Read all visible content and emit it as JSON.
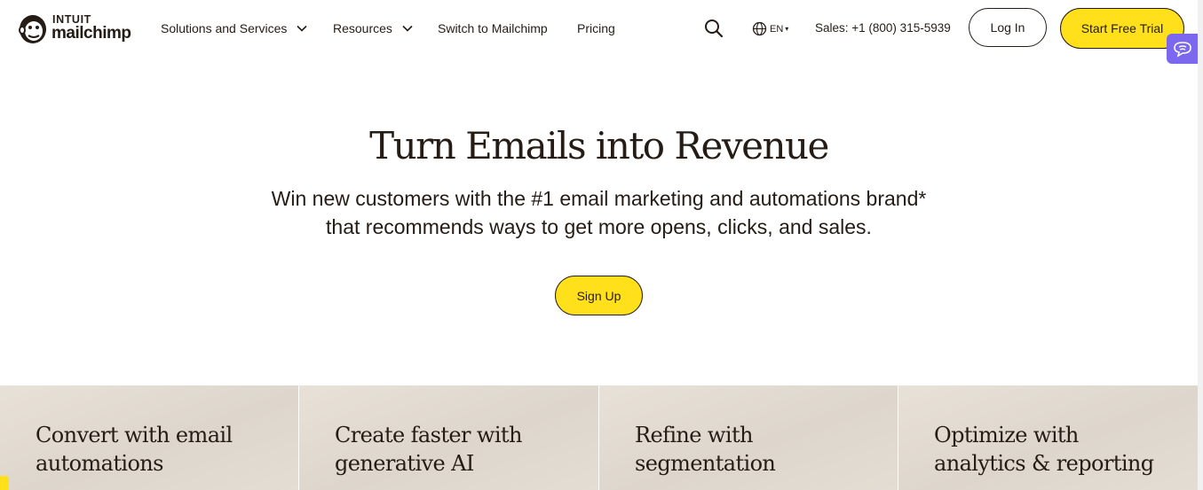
{
  "brand": {
    "top": "INTUIT",
    "name": "mailchimp"
  },
  "nav": {
    "items": [
      {
        "label": "Solutions and Services",
        "has_dropdown": true
      },
      {
        "label": "Resources",
        "has_dropdown": true
      },
      {
        "label": "Switch to Mailchimp",
        "has_dropdown": false
      },
      {
        "label": "Pricing",
        "has_dropdown": false
      }
    ],
    "language": "EN",
    "sales": "Sales: +1 (800) 315-5939",
    "login_label": "Log In",
    "trial_label": "Start Free Trial"
  },
  "hero": {
    "title": "Turn Emails into Revenue",
    "subtitle_line1": "Win new customers with the #1 email marketing and automations brand*",
    "subtitle_line2": "that recommends ways to get more opens, clicks, and sales.",
    "cta_label": "Sign Up"
  },
  "cards": [
    {
      "line1": "Convert with email",
      "line2": "automations"
    },
    {
      "line1": "Create faster with",
      "line2": "generative AI"
    },
    {
      "line1": "Refine with",
      "line2": "segmentation"
    },
    {
      "line1": "Optimize with",
      "line2": "analytics & reporting"
    }
  ],
  "colors": {
    "accent": "#ffe01b",
    "ink": "#241c15",
    "assistant": "#7b68ee",
    "card_bg": "#e3ddd4"
  },
  "icons": [
    "mailchimp-logo-icon",
    "chevron-down-icon",
    "search-icon",
    "globe-icon",
    "assistant-chat-icon"
  ]
}
